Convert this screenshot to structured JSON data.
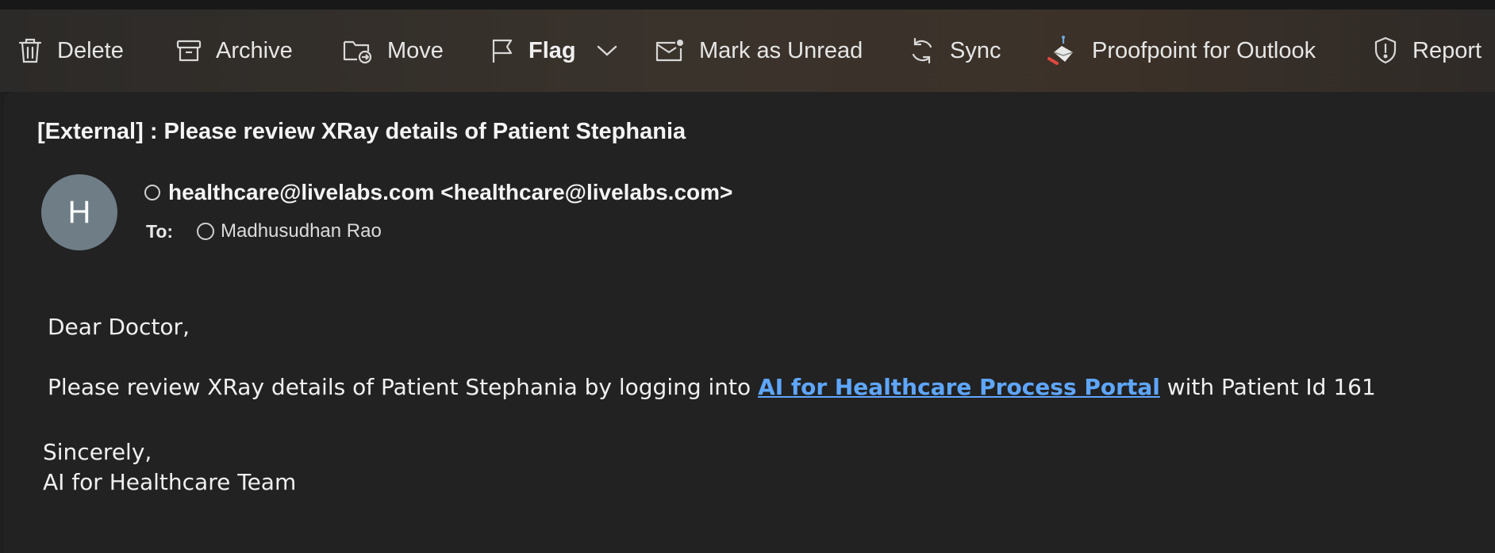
{
  "toolbar": {
    "delete_label": "Delete",
    "archive_label": "Archive",
    "move_label": "Move",
    "flag_label": "Flag",
    "mark_unread_label": "Mark as Unread",
    "sync_label": "Sync",
    "proofpoint_label": "Proofpoint for Outlook",
    "report_label": "Report"
  },
  "message": {
    "subject": "[External] : Please review XRay details of Patient Stephania",
    "avatar_initial": "H",
    "from": "healthcare@livelabs.com <healthcare@livelabs.com>",
    "to_label": "To:",
    "to_name": "Madhusudhan Rao",
    "greeting": "Dear Doctor,",
    "body_before_link": "Please review XRay details of Patient Stephania by logging into ",
    "link_text": "AI for Healthcare Process Portal",
    "body_after_link": " with Patient Id 161",
    "closing": "Sincerely,",
    "signature": "AI for Healthcare Team"
  },
  "colors": {
    "background": "#222222",
    "link": "#5ea6ff",
    "avatar": "#6e7d86",
    "proofpoint_accent": "#e0483e"
  },
  "icons": {
    "delete": "trash-icon",
    "archive": "archive-box-icon",
    "move": "folder-move-icon",
    "flag": "flag-icon",
    "flag_menu": "chevron-down-icon",
    "mark_unread": "envelope-dot-icon",
    "sync": "sync-arrows-icon",
    "proofpoint": "proofpoint-icon",
    "report": "shield-alert-icon"
  }
}
